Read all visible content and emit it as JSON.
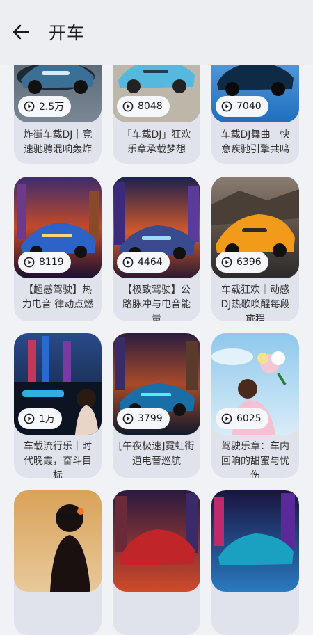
{
  "header": {
    "title": "开车"
  },
  "cards": [
    {
      "count": "2.5万",
      "title": "炸街车载DJ｜竞速驰骋混响轰炸"
    },
    {
      "count": "8048",
      "title": "「车载DJ」狂欢乐章承载梦想"
    },
    {
      "count": "7040",
      "title": "车载DJ舞曲｜快意疾驰引擎共鸣"
    },
    {
      "count": "8119",
      "title": "【超感驾驶】热力电音 律动点燃"
    },
    {
      "count": "4464",
      "title": "【极致驾驶】公路脉冲与电音能量"
    },
    {
      "count": "6396",
      "title": "车载狂欢｜动感DJ热歌唤醒每段旅程"
    },
    {
      "count": "1万",
      "title": "车载流行乐｜时代晚霞，奋斗目标"
    },
    {
      "count": "3799",
      "title": "[午夜极速]霓虹街道电音巡航"
    },
    {
      "count": "6025",
      "title": "驾驶乐章：车内回响的甜蜜与忧伤"
    },
    {
      "count": "",
      "title": ""
    },
    {
      "count": "",
      "title": ""
    },
    {
      "count": "",
      "title": ""
    }
  ]
}
